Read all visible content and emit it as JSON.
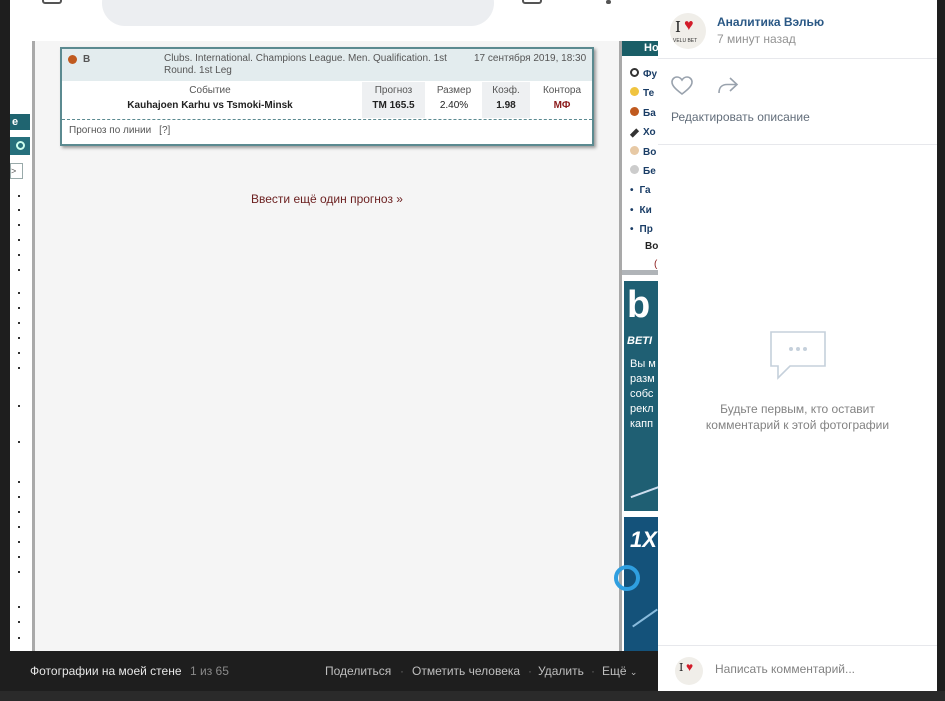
{
  "photo": {
    "left_sidebar": {
      "tab_label": "e",
      "box_label": ">"
    },
    "card": {
      "head_label": "В",
      "league": "Clubs. International. Champions League. Men. Qualification. 1st Round. 1st Leg",
      "date": "17 сентября 2019, 18:30",
      "columns": [
        "Событие",
        "Прогноз",
        "Размер",
        "Коэф.",
        "Контора"
      ],
      "event": "Kauhajoen Karhu vs Tsmoki-Minsk",
      "forecast": "ТМ 165.5",
      "size": "2.40%",
      "coef": "1.98",
      "bookmaker": "МФ",
      "footer": "Прогноз по линии",
      "footer_q": "[?]"
    },
    "link": "Ввести ещё один прогноз »",
    "right_sidebar": {
      "head": "Но",
      "items": [
        "Фу",
        "Те",
        "Ба",
        "Хо",
        "Во",
        "Бе"
      ],
      "bullets": [
        "Га",
        "Ки",
        "Пр"
      ],
      "extra": "Во",
      "extra2": "(",
      "banner1_big": "b",
      "banner1_sub": "BETI",
      "banner1_text": [
        "Вы м",
        "разм",
        "собс",
        "рекл",
        "капп"
      ],
      "banner2_big": "1X"
    }
  },
  "bottombar": {
    "title": "Фотографии на моей стене",
    "counter": "1 из 65",
    "share": "Поделиться",
    "tag": "Отметить человека",
    "delete": "Удалить",
    "more": "Ещё",
    "sep": "·"
  },
  "panel": {
    "author": "Аналитика Вэлью",
    "time": "7 минут назад",
    "edit_desc": "Редактировать описание",
    "empty_line1": "Будьте первым, кто оставит",
    "empty_line2": "комментарий к этой фотографии",
    "comment_placeholder": "Написать комментарий...",
    "avatar_text_top": "I",
    "avatar_text_bottom": "VELU BET"
  },
  "colors": {
    "accent": "#2a5885",
    "card_border": "#5b8a90",
    "link": "#6b1f1f",
    "bookmaker": "#8b1a1a"
  }
}
